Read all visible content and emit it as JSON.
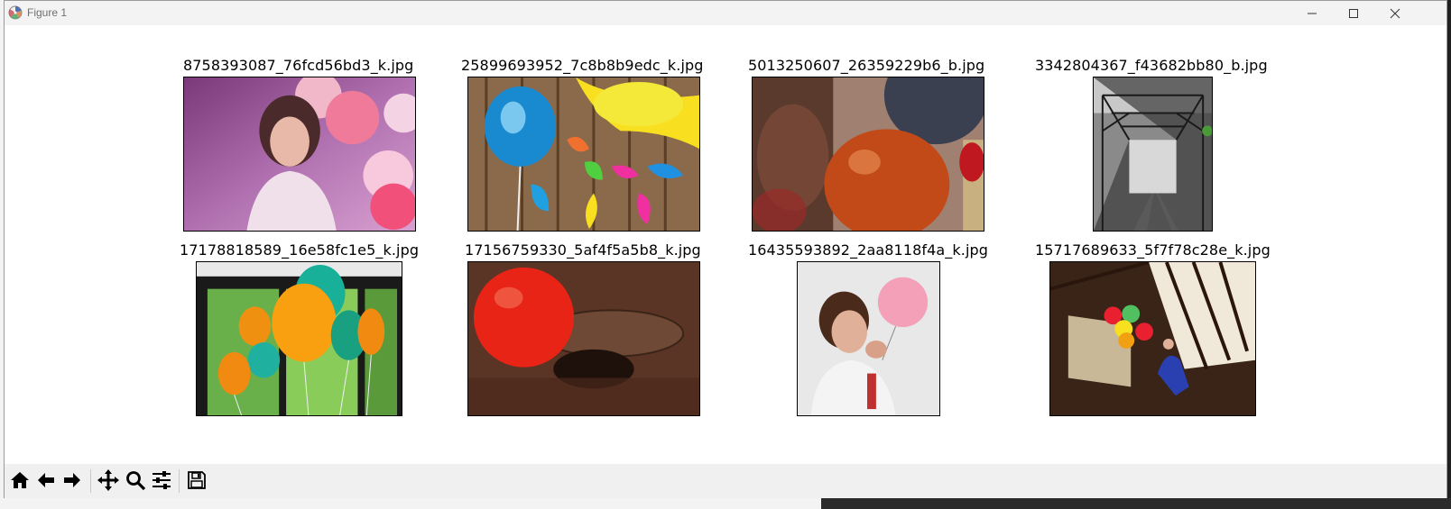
{
  "window": {
    "title": "Figure 1"
  },
  "panels": [
    {
      "filename": "8758393087_76fcd56bd3_k.jpg",
      "scene": "woman-with-balloons"
    },
    {
      "filename": "25899693952_7c8b8b9edc_k.jpg",
      "scene": "blue-balloon-feathers"
    },
    {
      "filename": "5013250607_26359229b6_b.jpg",
      "scene": "orange-balloon-closeup"
    },
    {
      "filename": "3342804367_f43682bb80_b.jpg",
      "scene": "bridge-tunnel-bw"
    },
    {
      "filename": "17178818589_16e58fc1e5_k.jpg",
      "scene": "balloons-window"
    },
    {
      "filename": "17156759330_5af4f5a5b8_k.jpg",
      "scene": "red-balloon-ground"
    },
    {
      "filename": "16435593892_2aa8118f4a_k.jpg",
      "scene": "girl-pink-balloon"
    },
    {
      "filename": "15717689633_5f7f78c28e_k.jpg",
      "scene": "child-balloons-bridge"
    }
  ],
  "toolbar": {
    "tools": [
      {
        "name": "home",
        "icon": "home-icon"
      },
      {
        "name": "back",
        "icon": "arrow-left-icon"
      },
      {
        "name": "forward",
        "icon": "arrow-right-icon"
      },
      {
        "name": "pan",
        "icon": "move-icon"
      },
      {
        "name": "zoom",
        "icon": "magnifier-icon"
      },
      {
        "name": "configure-subplots",
        "icon": "sliders-icon"
      },
      {
        "name": "save",
        "icon": "floppy-icon"
      }
    ]
  }
}
